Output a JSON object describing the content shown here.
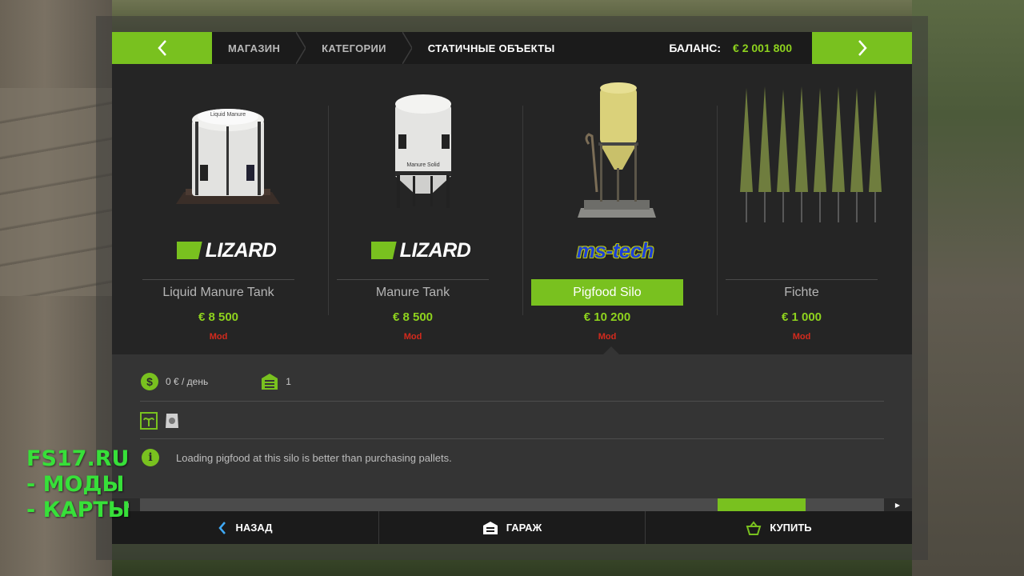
{
  "header": {
    "breadcrumbs": [
      "МАГАЗИН",
      "КАТЕГОРИИ",
      "СТАТИЧНЫЕ ОБЪЕКТЫ"
    ],
    "balance_label": "БАЛАНС:",
    "balance_value": "€ 2 001 800",
    "prev_icon": "chevron-left-icon",
    "next_icon": "chevron-right-icon"
  },
  "items": [
    {
      "name": "Liquid Manure Tank",
      "price": "€ 8 500",
      "tag": "Mod",
      "brand": "LIZARD",
      "brand_icon": "lizard-logo",
      "selected": false
    },
    {
      "name": "Manure Tank",
      "price": "€ 8 500",
      "tag": "Mod",
      "brand": "LIZARD",
      "brand_icon": "lizard-logo",
      "selected": false
    },
    {
      "name": "Pigfood Silo",
      "price": "€ 10 200",
      "tag": "Mod",
      "brand": "ms-tech",
      "brand_icon": "mstech-logo",
      "selected": true
    },
    {
      "name": "Fichte",
      "price": "€ 1 000",
      "tag": "Mod",
      "brand": "",
      "selected": false
    }
  ],
  "item_labels": {
    "tank1": "Liquid Manure",
    "tank2": "Manure Solid"
  },
  "details": {
    "upkeep": "0 € / день",
    "upkeep_icon": "dollar-gear-icon",
    "count": "1",
    "count_icon": "garage-icon",
    "fill_icons": [
      "plant-fill-icon",
      "pigfood-bag-icon"
    ],
    "description": "Loading pigfood at this silo is better than purchasing pallets.",
    "info_icon": "info-icon"
  },
  "scrollbar": {
    "position": 0.88
  },
  "footer": {
    "back_label": "НАЗАД",
    "garage_label": "ГАРАЖ",
    "buy_label": "КУПИТЬ"
  },
  "watermark": {
    "line1": "FS17.RU",
    "line2": "- МОДЫ",
    "line3": "- КАРТЫ"
  },
  "colors": {
    "accent": "#79c11f",
    "price": "#8ed21e",
    "mod_tag": "#d42a1d",
    "watermark": "#37e039"
  }
}
